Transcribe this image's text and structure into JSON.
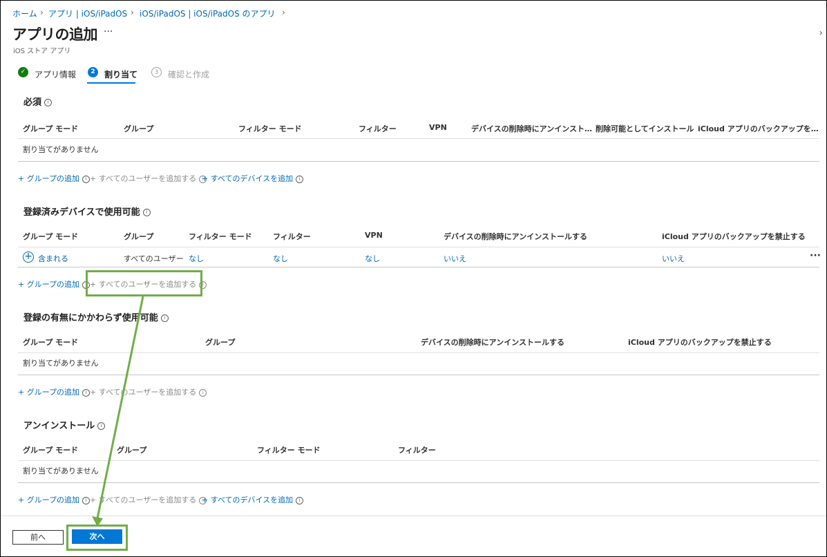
{
  "breadcrumb": [
    "ホーム",
    "アプリ | iOS/iPadOS",
    "iOS/iPadOS | iOS/iPadOS のアプリ"
  ],
  "page": {
    "title": "アプリの追加",
    "more": "···",
    "subtitle": "iOS ストア アプリ"
  },
  "steps": [
    {
      "num": "✓",
      "label": "アプリ情報"
    },
    {
      "num": "2",
      "label": "割り当て"
    },
    {
      "num": "3",
      "label": "確認と作成"
    }
  ],
  "required": {
    "title": "必須",
    "headers": [
      "グループ モード",
      "グループ",
      "フィルター モード",
      "フィルター",
      "VPN",
      "デバイスの削除時にアンインスト…",
      "削除可能としてインストール",
      "iCloud アプリのバックアップを…"
    ],
    "empty": "割り当てがありません",
    "links": [
      "+ グループの追加",
      "+ すべてのユーザーを追加する",
      "+ すべてのデバイスを追加"
    ]
  },
  "enrolled": {
    "title": "登録済みデバイスで使用可能",
    "headers": [
      "グループ モード",
      "グループ",
      "フィルター モード",
      "フィルター",
      "VPN",
      "デバイスの削除時にアンインストールする",
      "iCloud アプリのバックアップを禁止する"
    ],
    "row": {
      "mode": "含まれる",
      "group": "すべてのユーザー",
      "filter_mode": "なし",
      "filter": "なし",
      "vpn": "なし",
      "uninstall": "いいえ",
      "backup": "いいえ",
      "more": "···"
    },
    "links": [
      "+ グループの追加",
      "+ すべてのユーザーを追加する"
    ]
  },
  "available": {
    "title": "登録の有無にかかわらず使用可能",
    "headers": [
      "グループ モード",
      "グループ",
      "デバイスの削除時にアンインストールする",
      "iCloud アプリのバックアップを禁止する"
    ],
    "empty": "割り当てがありません",
    "links": [
      "+ グループの追加",
      "+ すべてのユーザーを追加する"
    ]
  },
  "uninstall": {
    "title": "アンインストール",
    "headers": [
      "グループ モード",
      "グループ",
      "フィルター モード",
      "フィルター"
    ],
    "empty": "割り当てがありません",
    "links": [
      "+ グループの追加",
      "+ すべてのユーザーを追加する",
      "+ すべてのデバイスを追加"
    ]
  },
  "footer": {
    "prev": "前へ",
    "next": "次へ"
  },
  "colors": {
    "accent": "#0078d4",
    "link": "#0067b8",
    "highlight": "#70ad47",
    "success": "#107c10"
  }
}
